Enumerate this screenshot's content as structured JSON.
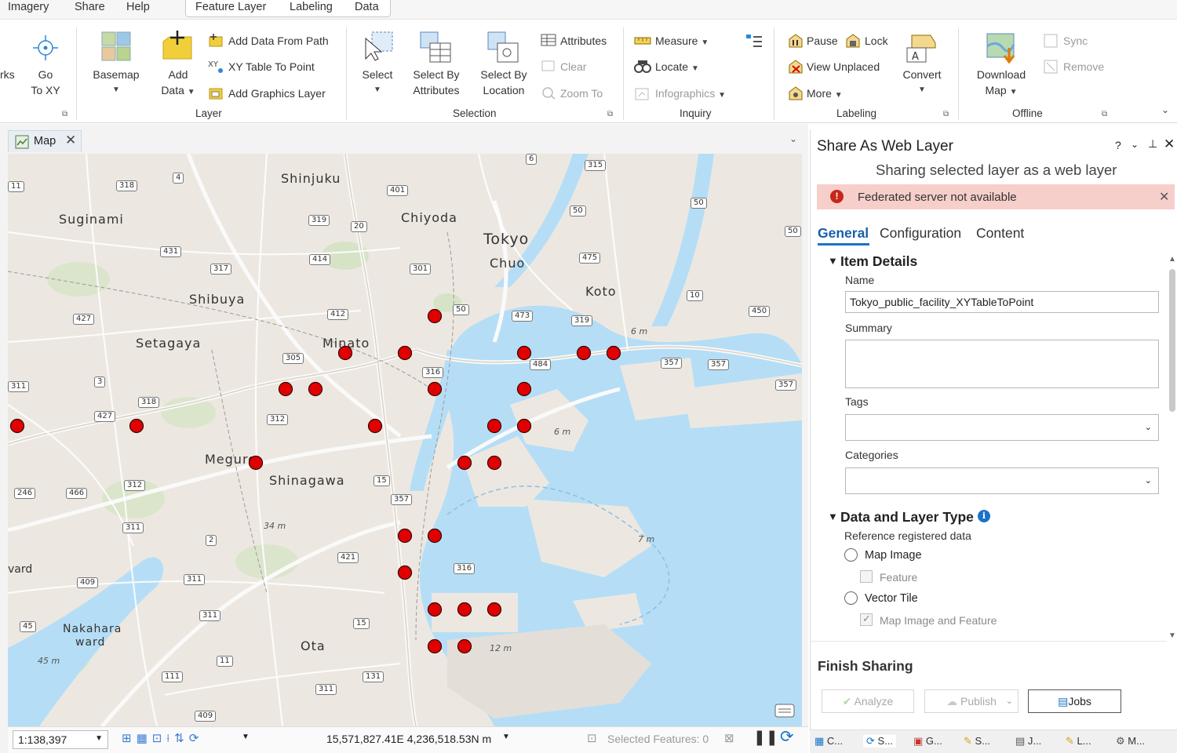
{
  "menu": {
    "tabs": [
      "Imagery",
      "Share",
      "Help"
    ],
    "context_tabs": [
      "Feature Layer",
      "Labeling",
      "Data"
    ]
  },
  "ribbon": {
    "navigate": {
      "cut_label": "rks",
      "goxy_line1": "Go",
      "goxy_line2": "To XY"
    },
    "layer": {
      "title": "Layer",
      "basemap": "Basemap",
      "add_data_line1": "Add",
      "add_data_line2": "Data",
      "add_data_from_path": "Add Data From Path",
      "xy_table_to_point": "XY Table To Point",
      "add_graphics_layer": "Add Graphics Layer"
    },
    "selection": {
      "title": "Selection",
      "select": "Select",
      "select_by_attr_line1": "Select By",
      "select_by_attr_line2": "Attributes",
      "select_by_loc_line1": "Select By",
      "select_by_loc_line2": "Location",
      "attributes": "Attributes",
      "clear": "Clear",
      "zoom_to": "Zoom To"
    },
    "inquiry": {
      "title": "Inquiry",
      "measure": "Measure",
      "locate": "Locate",
      "infographics": "Infographics"
    },
    "labeling": {
      "title": "Labeling",
      "pause": "Pause",
      "lock": "Lock",
      "view_unplaced": "View Unplaced",
      "more": "More",
      "convert": "Convert"
    },
    "offline": {
      "title": "Offline",
      "download_line1": "Download",
      "download_line2": "Map",
      "sync": "Sync",
      "remove": "Remove"
    }
  },
  "map_tab": {
    "label": "Map"
  },
  "map": {
    "labels": {
      "shinjuku": "Shinjuku",
      "suginami": "Suginami",
      "chiyoda": "Chiyoda",
      "tokyo": "Tokyo",
      "chuo": "Chuo",
      "koto": "Koto",
      "shibuya": "Shibuya",
      "setagaya": "Setagaya",
      "minato": "Minato",
      "meguro": "Meguro",
      "shinagawa": "Shinagawa",
      "nakahara1": "Nakahara",
      "nakahara2": "ward",
      "ota": "Ota",
      "ward_left": "vard"
    },
    "depths": {
      "d6a": "6 m",
      "d6b": "6 m",
      "d7": "7 m",
      "d12": "12 m",
      "d34": "34 m",
      "d45": "45 m"
    },
    "shields": [
      "6",
      "315",
      "4",
      "318",
      "401",
      "50",
      "50",
      "50",
      "20",
      "319",
      "431",
      "414",
      "475",
      "317",
      "301",
      "10",
      "427",
      "412",
      "50",
      "473",
      "450",
      "319",
      "305",
      "484",
      "357",
      "357",
      "357",
      "3",
      "316",
      "311",
      "318",
      "427",
      "312",
      "15",
      "246",
      "466",
      "312",
      "357",
      "311",
      "2",
      "421",
      "316",
      "409",
      "311",
      "45",
      "311",
      "15",
      "11",
      "111",
      "131",
      "311",
      "409",
      "11"
    ]
  },
  "statusbar": {
    "scale": "1:138,397",
    "coords": "15,571,827.41E 4,236,518.53N m",
    "selected": "Selected Features: 0"
  },
  "pane": {
    "title": "Share As Web Layer",
    "subtitle": "Sharing selected layer as a web layer",
    "alert": "Federated server not available",
    "tabs": [
      "General",
      "Configuration",
      "Content"
    ],
    "item_details": "Item Details",
    "name_label": "Name",
    "name_value": "Tokyo_public_facility_XYTableToPoint",
    "summary_label": "Summary",
    "tags_label": "Tags",
    "categories_label": "Categories",
    "data_layer_type": "Data and Layer Type",
    "reference_registered": "Reference registered data",
    "map_image": "Map Image",
    "feature": "Feature",
    "vector_tile": "Vector Tile",
    "map_image_feature": "Map Image and Feature",
    "finish_sharing": "Finish Sharing",
    "analyze": "Analyze",
    "publish": "Publish",
    "jobs": "Jobs",
    "controls": {
      "help": "?",
      "pin": "⊥"
    }
  },
  "bottom_tabs": [
    "C...",
    "S...",
    "G...",
    "S...",
    "J...",
    "L...",
    "M..."
  ],
  "colors": {
    "water": "#b5def6",
    "land": "#ece8e1",
    "point": "#e00000",
    "accent": "#1a73c8",
    "alert_bg": "#f6cfca"
  }
}
